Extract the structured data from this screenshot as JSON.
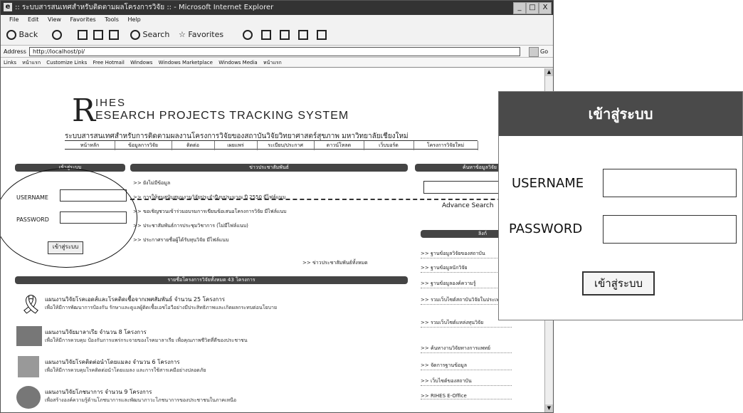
{
  "window": {
    "title": ":: ระบบสารสนเทศสำหรับติดตามผลโครงการวิจัย :: - Microsoft Internet Explorer",
    "min": "_",
    "max": "□",
    "close": "X"
  },
  "menubar": [
    "File",
    "Edit",
    "View",
    "Favorites",
    "Tools",
    "Help"
  ],
  "toolbar": {
    "back": "Back",
    "search": "Search",
    "favorites": "Favorites"
  },
  "address": {
    "label": "Address",
    "url": "http://localhost/pi/",
    "go": "Go"
  },
  "links": {
    "label": "Links",
    "items": [
      "หน้าแรก",
      "Customize Links",
      "Free Hotmail",
      "Windows",
      "Windows Marketplace",
      "Windows Media",
      "หน้าแรก"
    ]
  },
  "site": {
    "logo_initial": "R",
    "logo_top": "IHES",
    "logo_bottom": "ESEARCH PROJECTS TRACKING SYSTEM",
    "subtitle": "ระบบสารสนเทศสำหรับการติดตามผลงานโครงการวิจัยของสถาบันวิจัยวิทยาศาสตร์สุขภาพ มหาวิทยาลัยเชียงใหม่",
    "nav": [
      "หน้าหลัก",
      "ข้อมูลการวิจัย",
      "ติดต่อ",
      "เผยแพร่",
      "ระเบียบ/ประกาศ",
      "ดาวน์โหลด",
      "เว็บบอร์ด",
      "โครงการวิจัยใหม่"
    ]
  },
  "login": {
    "header": "เข้าสู่ระบบ",
    "username_label": "USERNAME",
    "password_label": "PASSWORD",
    "button": "เข้าสู่ระบบ"
  },
  "news": {
    "header": "ข่าวประชาสัมพันธ์",
    "items": [
      ">> ยังไม่มีข้อมูล",
      ">> การให้ทุนสนับสนุนงานวิจัยประจำปีงบประมาณ ปี 2550 มีไฟล์แนบ",
      ">> ขอเชิญชวนเข้าร่วมอบรมการเขียนข้อเสนอโครงการวิจัย มีไฟล์แนบ",
      ">> ประชาสัมพันธ์การประชุมวิชาการ (ไม่มีไฟล์แนบ)",
      ">> ประกาศรายชื่อผู้ได้รับทุนวิจัย มีไฟล์แนบ"
    ],
    "more": ">> ข่าวประชาสัมพันธ์ทั้งหมด"
  },
  "search": {
    "header": "ค้นหาข้อมูลวิจัย",
    "advance": "Advance Search"
  },
  "projects": {
    "header": "รายชื่อโครงการวิจัยทั้งหมด 43 โครงการ",
    "items": [
      {
        "title": "แผนงานวิจัยโรคเอดส์และโรคติดเชื้อจากเพศสัมพันธ์ จำนวน 25 โครงการ",
        "desc": "เพื่อให้มีการพัฒนาการป้องกัน รักษาและดูแลผู้ติดเชื้อเอชไอวีอย่างมีประสิทธิภาพและเกิดผลกระทบต่อนโยบาย"
      },
      {
        "title": "แผนงานวิจัยมาลาเรีย จำนวน 8 โครงการ",
        "desc": "เพื่อให้มีการควบคุม ป้องกันการแพร่กระจายของโรคมาลาเรีย เพื่อคุณภาพชีวิตที่ดีของประชาชน"
      },
      {
        "title": "แผนงานวิจัยโรคติดต่อนำโดยแมลง จำนวน 6 โครงการ",
        "desc": "เพื่อให้มีการควบคุมโรคติดต่อนำโดยแมลง และการใช้สารเคมีอย่างปลอดภัย"
      },
      {
        "title": "แผนงานวิจัยโภชนาการ จำนวน 9 โครงการ",
        "desc": "เพื่อสร้างองค์ความรู้ด้านโภชนาการและพัฒนาภาวะโภชนาการของประชาชนในภาคเหนือ"
      }
    ]
  },
  "sidelinks": {
    "header": "ลิงก์",
    "items": [
      ">> ฐานข้อมูลวิจัยของสถาบัน",
      ">> ฐานข้อมูลนักวิจัย",
      ">> ฐานข้อมูลองค์ความรู้",
      ">> รวมเว็บไซต์สถาบันวิจัยในประเทศไทย",
      ">> รวมเว็บไซต์แหล่งทุนวิจัย",
      ">> ค้นหางานวิจัยทางการแพทย์",
      ">> จัดการฐานข้อมูล",
      ">> เว็บไซต์ของสถาบัน",
      ">> RIHES E-Office"
    ]
  },
  "zoom": {
    "header": "เข้าสู่ระบบ",
    "username_label": "USERNAME",
    "password_label": "PASSWORD",
    "button": "เข้าสู่ระบบ"
  }
}
